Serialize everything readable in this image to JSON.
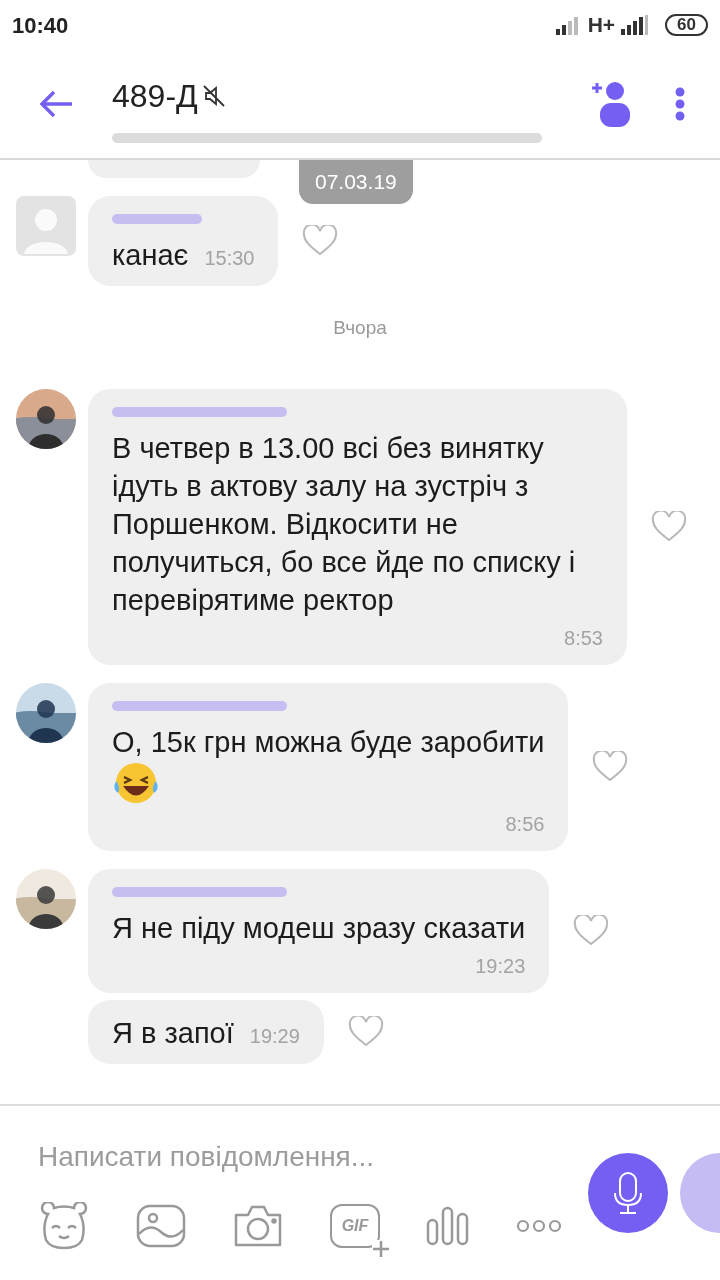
{
  "status_bar": {
    "time": "10:40",
    "network": "H+",
    "battery": "60"
  },
  "header": {
    "title": "489-Д",
    "muted": true
  },
  "date_pill": "07.03.19",
  "messages": [
    {
      "kind": "default_avatar",
      "text": "канає",
      "time": "15:30",
      "emoji": false
    },
    {
      "kind": "separator",
      "text": "Вчора"
    },
    {
      "kind": "photo_avatar",
      "text": "В четвер в 13.00 всі без винятку ідуть в актову залу на зустріч з Поршенком. Відкосити не получиться, бо все йде по списку і перевірятиме ректор",
      "time": "8:53",
      "emoji": false
    },
    {
      "kind": "photo_avatar",
      "text": "О, 15к грн можна буде заробити",
      "time": "8:56",
      "emoji": true
    },
    {
      "kind": "photo_avatar",
      "text": "Я не піду модеш зразу сказати",
      "time": "19:23",
      "emoji": false
    },
    {
      "kind": "continuation",
      "text": "Я в запої",
      "time": "19:29",
      "emoji": false
    }
  ],
  "composer": {
    "placeholder": "Написати повідомлення...",
    "gif_label": "GIF"
  }
}
